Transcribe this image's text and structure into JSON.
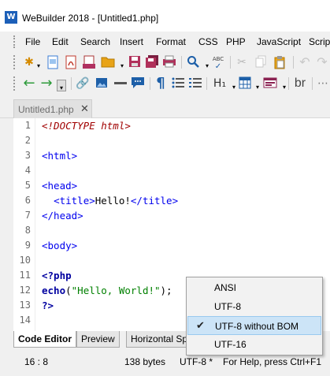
{
  "window": {
    "title": "WeBuilder 2018 - [Untitled1.php]",
    "logo_text": "W"
  },
  "menu": [
    "File",
    "Edit",
    "Search",
    "Insert",
    "Format",
    "CSS",
    "PHP",
    "JavaScript",
    "Script"
  ],
  "toolbar1": {
    "icons": [
      "new-file-icon",
      "new-page-icon",
      "pdf-icon",
      "php-icon",
      "open-folder-icon",
      "save-icon",
      "save-all-icon",
      "print-icon",
      "search-icon",
      "spellcheck-icon",
      "cut-icon",
      "copy-icon",
      "paste-icon",
      "undo-icon"
    ],
    "spellcheck_text": "ABC"
  },
  "toolbar2": {
    "icons": [
      "back-arrow-icon",
      "forward-arrow-icon",
      "toolbar-options-icon",
      "link-icon",
      "image-icon",
      "horizontal-rule-icon",
      "comment-icon",
      "paragraph-icon",
      "unordered-list-icon",
      "ordered-list-icon",
      "heading-icon",
      "table-icon",
      "form-icon",
      "line-break-icon",
      "more-icon"
    ],
    "heading_label": "H₁",
    "br_label": "br"
  },
  "document_tab": {
    "label": "Untitled1.php",
    "close_glyph": "✕"
  },
  "editor": {
    "line_numbers": [
      "1",
      "2",
      "3",
      "4",
      "5",
      "6",
      "7",
      "8",
      "9",
      "10",
      "11",
      "12",
      "13",
      "14"
    ],
    "lines": [
      {
        "n": 1,
        "segments": [
          {
            "t": "<!DOCTYPE html>",
            "c": "doc"
          }
        ]
      },
      {
        "n": 2,
        "segments": []
      },
      {
        "n": 3,
        "segments": [
          {
            "t": "<html>",
            "c": "tag"
          }
        ]
      },
      {
        "n": 4,
        "segments": []
      },
      {
        "n": 5,
        "segments": [
          {
            "t": "<head>",
            "c": "tag"
          }
        ]
      },
      {
        "n": 6,
        "segments": [
          {
            "t": "  ",
            "c": "plain"
          },
          {
            "t": "<title>",
            "c": "tag"
          },
          {
            "t": "Hello!",
            "c": "plain"
          },
          {
            "t": "</title>",
            "c": "tag"
          }
        ]
      },
      {
        "n": 7,
        "segments": [
          {
            "t": "</head>",
            "c": "tag"
          }
        ]
      },
      {
        "n": 8,
        "segments": []
      },
      {
        "n": 9,
        "segments": [
          {
            "t": "<body>",
            "c": "tag"
          }
        ]
      },
      {
        "n": 10,
        "segments": []
      },
      {
        "n": 11,
        "segments": [
          {
            "t": "<?php",
            "c": "php"
          }
        ]
      },
      {
        "n": 12,
        "segments": [
          {
            "t": "echo",
            "c": "php"
          },
          {
            "t": "(",
            "c": "plain"
          },
          {
            "t": "\"Hello, World!\"",
            "c": "str"
          },
          {
            "t": ");",
            "c": "plain"
          }
        ]
      },
      {
        "n": 13,
        "segments": [
          {
            "t": "?>",
            "c": "php"
          }
        ]
      },
      {
        "n": 14,
        "segments": []
      }
    ]
  },
  "bottom_tabs": [
    "Code Editor",
    "Preview",
    "Horizontal Sp"
  ],
  "status": {
    "position": "16 : 8",
    "size": "138 bytes",
    "encoding": "UTF-8 *",
    "help": "For Help, press Ctrl+F1"
  },
  "encoding_menu": {
    "items": [
      "ANSI",
      "UTF-8",
      "UTF-8 without BOM",
      "UTF-16"
    ],
    "checked_index": 2,
    "check_glyph": "✔"
  },
  "colors": {
    "tag": "#0000ee",
    "doctype": "#a00000",
    "php": "#0000a0",
    "string": "#008000",
    "logo": "#1c5fb8",
    "hover": "#cce4f7"
  }
}
